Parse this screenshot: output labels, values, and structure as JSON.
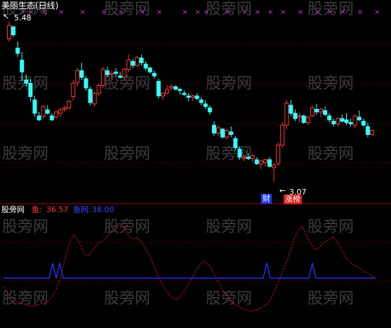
{
  "colors": {
    "background": "#000000",
    "grid": "#7a0000",
    "up": "#ff3b3b",
    "down": "#33ffff",
    "title": "#ffffff",
    "x_marks": "#cc33cc",
    "series_dashed": "#cc1111",
    "series_blue": "#2233ff"
  },
  "main_panel": {
    "title": "美丽生态(日线)",
    "high_label": "5.48",
    "low_label": "3.07",
    "marker_cai": "财",
    "marker_zhangbang": "涨榜"
  },
  "sub_panel": {
    "name": "股旁网",
    "series1_label": "鱼:",
    "series1_value": "36.57",
    "series2_label": "鱼网:",
    "series2_value": "38.00"
  },
  "watermark": "股旁网",
  "chart_data": [
    {
      "type": "candlestick",
      "title": "美丽生态(日线)",
      "ylim": [
        2.95,
        5.55
      ],
      "annotations": [
        "5.48",
        "3.07",
        "财",
        "涨榜"
      ],
      "x_marks_top": [
        3,
        5,
        8,
        12,
        17,
        22,
        26,
        31,
        35,
        41,
        44,
        46,
        51,
        55,
        58,
        61,
        64,
        68,
        72,
        75,
        78,
        82,
        86
      ],
      "ohlc": [
        [
          5.22,
          5.48,
          5.18,
          5.42
        ],
        [
          5.4,
          5.42,
          5.25,
          5.28
        ],
        [
          5.08,
          5.18,
          4.95,
          5.0
        ],
        [
          4.9,
          5.02,
          4.58,
          4.72
        ],
        [
          4.6,
          4.68,
          4.5,
          4.55
        ],
        [
          4.55,
          4.62,
          4.28,
          4.35
        ],
        [
          4.3,
          4.36,
          4.05,
          4.1
        ],
        [
          4.06,
          4.12,
          3.98,
          4.0
        ],
        [
          4.05,
          4.22,
          4.02,
          4.2
        ],
        [
          4.15,
          4.22,
          4.08,
          4.1
        ],
        [
          4.06,
          4.1,
          3.98,
          4.0
        ],
        [
          4.04,
          4.14,
          4.02,
          4.12
        ],
        [
          4.1,
          4.18,
          4.05,
          4.15
        ],
        [
          4.16,
          4.22,
          4.12,
          4.18
        ],
        [
          4.18,
          4.3,
          4.16,
          4.28
        ],
        [
          4.35,
          4.6,
          4.3,
          4.55
        ],
        [
          4.56,
          4.78,
          4.5,
          4.74
        ],
        [
          4.74,
          4.86,
          4.6,
          4.64
        ],
        [
          4.62,
          4.66,
          4.44,
          4.48
        ],
        [
          4.46,
          4.5,
          4.22,
          4.26
        ],
        [
          4.24,
          4.42,
          4.2,
          4.4
        ],
        [
          4.4,
          4.55,
          4.36,
          4.52
        ],
        [
          4.52,
          4.8,
          4.48,
          4.76
        ],
        [
          4.74,
          4.8,
          4.64,
          4.68
        ],
        [
          4.68,
          4.74,
          4.62,
          4.7
        ],
        [
          4.72,
          4.78,
          4.66,
          4.7
        ],
        [
          4.66,
          4.72,
          4.62,
          4.64
        ],
        [
          4.64,
          4.78,
          4.62,
          4.76
        ],
        [
          4.76,
          4.98,
          4.72,
          4.9
        ],
        [
          4.88,
          4.92,
          4.78,
          4.82
        ],
        [
          4.82,
          4.96,
          4.8,
          4.94
        ],
        [
          4.93,
          4.98,
          4.82,
          4.86
        ],
        [
          4.84,
          4.88,
          4.74,
          4.78
        ],
        [
          4.78,
          4.8,
          4.7,
          4.72
        ],
        [
          4.7,
          4.74,
          4.62,
          4.66
        ],
        [
          4.58,
          4.62,
          4.32,
          4.36
        ],
        [
          4.36,
          4.42,
          4.3,
          4.4
        ],
        [
          4.4,
          4.52,
          4.38,
          4.46
        ],
        [
          4.48,
          4.54,
          4.44,
          4.5
        ],
        [
          4.5,
          4.52,
          4.44,
          4.46
        ],
        [
          4.46,
          4.48,
          4.38,
          4.44
        ],
        [
          4.4,
          4.44,
          4.36,
          4.38
        ],
        [
          4.36,
          4.4,
          4.28,
          4.34
        ],
        [
          4.34,
          4.38,
          4.28,
          4.36
        ],
        [
          4.36,
          4.4,
          4.3,
          4.32
        ],
        [
          4.3,
          4.34,
          4.22,
          4.26
        ],
        [
          4.24,
          4.3,
          4.16,
          4.2
        ],
        [
          4.18,
          4.22,
          4.08,
          4.12
        ],
        [
          3.92,
          3.98,
          3.76,
          3.8
        ],
        [
          3.8,
          3.92,
          3.76,
          3.88
        ],
        [
          3.86,
          3.88,
          3.72,
          3.74
        ],
        [
          3.74,
          3.86,
          3.7,
          3.84
        ],
        [
          3.82,
          3.9,
          3.74,
          3.78
        ],
        [
          3.72,
          3.76,
          3.54,
          3.58
        ],
        [
          3.56,
          3.6,
          3.4,
          3.44
        ],
        [
          3.42,
          3.48,
          3.38,
          3.44
        ],
        [
          3.44,
          3.5,
          3.4,
          3.42
        ],
        [
          3.42,
          3.48,
          3.36,
          3.46
        ],
        [
          3.4,
          3.44,
          3.32,
          3.34
        ],
        [
          3.34,
          3.4,
          3.26,
          3.38
        ],
        [
          3.36,
          3.42,
          3.3,
          3.4
        ],
        [
          3.4,
          3.44,
          3.28,
          3.3
        ],
        [
          3.28,
          3.36,
          3.07,
          3.32
        ],
        [
          3.34,
          3.66,
          3.3,
          3.62
        ],
        [
          3.62,
          3.96,
          3.58,
          3.92
        ],
        [
          3.92,
          4.3,
          3.86,
          4.25
        ],
        [
          4.22,
          4.3,
          4.06,
          4.1
        ],
        [
          4.1,
          4.16,
          3.98,
          4.02
        ],
        [
          4.04,
          4.1,
          3.96,
          4.06
        ],
        [
          4.06,
          4.08,
          3.94,
          3.96
        ],
        [
          3.96,
          4.06,
          3.92,
          4.04
        ],
        [
          4.06,
          4.22,
          4.04,
          4.18
        ],
        [
          4.16,
          4.24,
          4.08,
          4.12
        ],
        [
          4.12,
          4.18,
          4.04,
          4.16
        ],
        [
          4.14,
          4.2,
          4.06,
          4.08
        ],
        [
          4.06,
          4.1,
          3.96,
          4.0
        ],
        [
          3.98,
          4.02,
          3.9,
          3.94
        ],
        [
          3.94,
          4.04,
          3.9,
          4.02
        ],
        [
          4.02,
          4.08,
          3.96,
          3.98
        ],
        [
          4.0,
          4.1,
          3.92,
          3.96
        ],
        [
          3.96,
          4.02,
          3.9,
          3.94
        ],
        [
          3.92,
          4.08,
          3.88,
          4.06
        ],
        [
          4.04,
          4.14,
          3.98,
          4.0
        ],
        [
          3.98,
          4.02,
          3.9,
          3.92
        ],
        [
          3.9,
          3.96,
          3.74,
          3.78
        ],
        [
          3.78,
          3.86,
          3.76,
          3.84
        ]
      ]
    },
    {
      "type": "line",
      "series": [
        {
          "name": "鱼",
          "style": "dashed",
          "values": [
            30,
            26,
            22,
            18,
            16,
            15,
            14,
            13,
            12,
            13,
            14,
            15,
            16,
            18,
            22,
            28,
            36,
            48,
            62,
            72,
            78,
            74,
            68,
            60,
            58,
            62,
            66,
            70,
            72,
            74,
            78,
            82,
            86,
            88,
            86,
            80,
            76,
            74,
            76,
            72,
            68,
            62,
            56,
            48,
            40,
            34,
            28,
            24,
            20,
            18,
            20,
            24,
            28,
            34,
            40,
            46,
            50,
            54,
            52,
            48,
            42,
            36,
            30,
            24,
            20,
            16,
            14,
            12,
            10,
            9,
            8,
            8,
            9,
            10,
            12,
            14,
            18,
            24,
            32,
            40,
            48,
            56,
            66,
            76,
            82,
            86,
            80,
            72,
            68,
            64,
            66,
            70,
            72,
            74,
            76,
            72,
            66,
            60,
            55,
            52,
            50,
            48,
            46,
            44,
            42,
            40,
            38
          ]
        },
        {
          "name": "鱼网",
          "style": "solid",
          "values": [
            38,
            38,
            38,
            38,
            38,
            38,
            38,
            38,
            38,
            38,
            38,
            38,
            38,
            38,
            52,
            38,
            52,
            38,
            38,
            38,
            38,
            38,
            38,
            38,
            38,
            38,
            38,
            38,
            38,
            38,
            38,
            38,
            38,
            38,
            38,
            38,
            38,
            38,
            38,
            38,
            38,
            38,
            38,
            38,
            38,
            38,
            38,
            38,
            38,
            38,
            38,
            38,
            38,
            38,
            38,
            38,
            38,
            38,
            38,
            38,
            38,
            38,
            38,
            38,
            38,
            38,
            38,
            38,
            38,
            38,
            38,
            38,
            38,
            38,
            38,
            52,
            38,
            38,
            38,
            38,
            38,
            38,
            38,
            38,
            38,
            38,
            38,
            38,
            52,
            38,
            38,
            38,
            38,
            38,
            38,
            38,
            38,
            38,
            38,
            38,
            38,
            38,
            38,
            38,
            38,
            38,
            38
          ]
        }
      ],
      "ylim": [
        0,
        100
      ]
    }
  ]
}
